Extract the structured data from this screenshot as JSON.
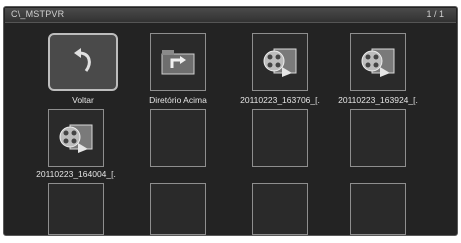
{
  "window": {
    "title": "C\\_MSTPVR",
    "page_indicator": "1 / 1"
  },
  "items": [
    {
      "label": "Voltar",
      "icon": "back-arrow-icon"
    },
    {
      "label": "Diretório Acima",
      "icon": "parent-folder-icon"
    },
    {
      "label": "20110223_163706_[.",
      "icon": "video-file-icon"
    },
    {
      "label": "20110223_163924_[.",
      "icon": "video-file-icon"
    },
    {
      "label": "20110223_164004_[.",
      "icon": "video-file-icon"
    }
  ]
}
